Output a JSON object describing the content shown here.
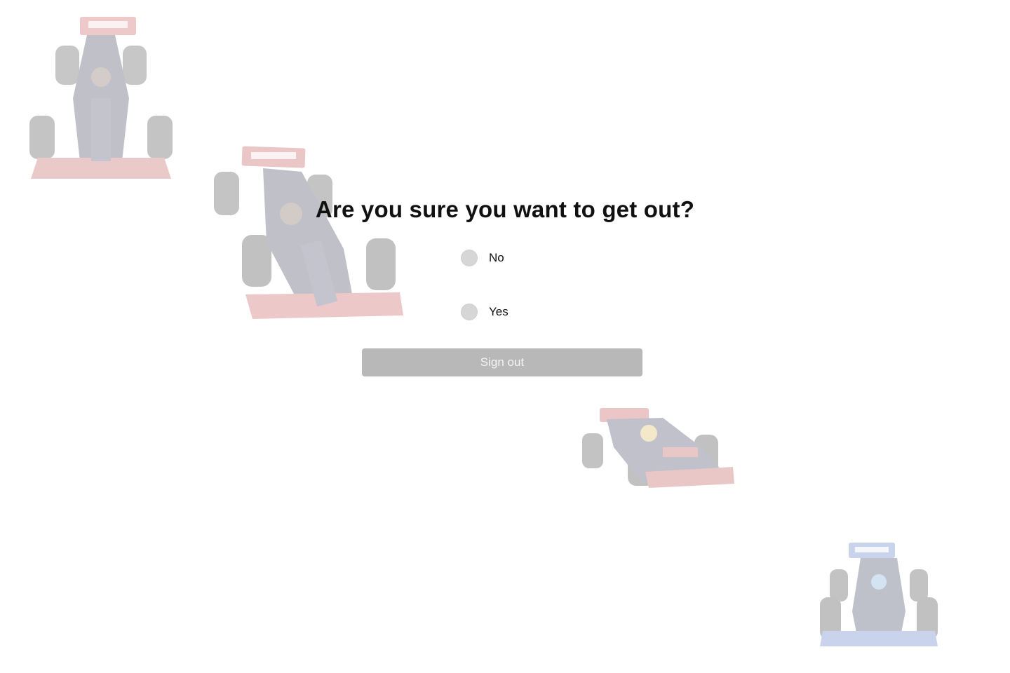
{
  "dialog": {
    "title": "Are you sure you want to get out?",
    "options": [
      {
        "label": "No",
        "selected": false
      },
      {
        "label": "Yes",
        "selected": false
      }
    ],
    "signout_label": "Sign out",
    "signout_enabled": false
  },
  "background": {
    "images": [
      {
        "name": "race-car-image",
        "primary_color": "#d23a3a"
      },
      {
        "name": "race-car-image",
        "primary_color": "#c83030"
      },
      {
        "name": "race-car-image",
        "primary_color": "#d03030"
      },
      {
        "name": "race-car-image",
        "primary_color": "#3a66c8"
      }
    ]
  },
  "colors": {
    "button_disabled": "#b8b8b8",
    "radio_unchecked": "#d6d6d6",
    "text": "#111111"
  }
}
